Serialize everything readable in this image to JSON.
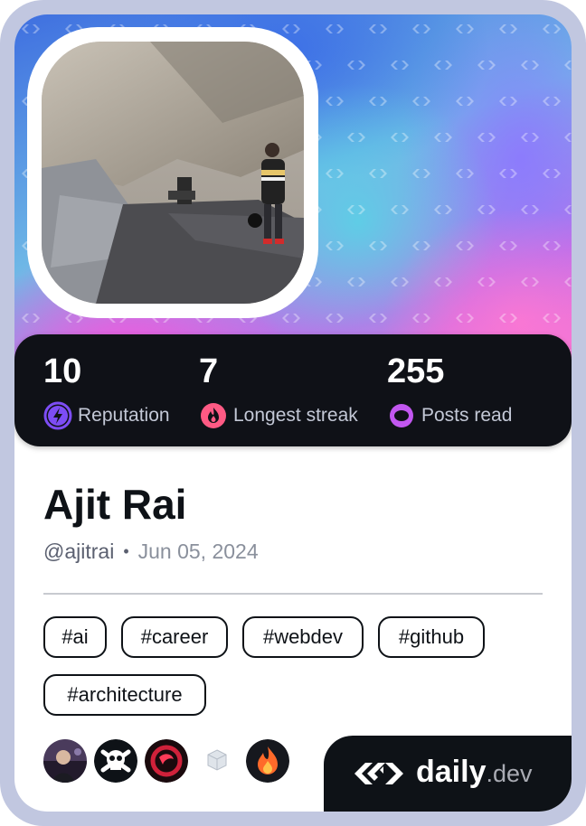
{
  "profile": {
    "name": "Ajit Rai",
    "handle": "@ajitrai",
    "separator": "•",
    "date": "Jun 05, 2024"
  },
  "stats": [
    {
      "value": "10",
      "label": "Reputation",
      "icon": "lightning-icon",
      "color": "#7d4df5"
    },
    {
      "value": "7",
      "label": "Longest streak",
      "icon": "flame-icon",
      "color": "#ff5a84"
    },
    {
      "value": "255",
      "label": "Posts read",
      "icon": "eye-icon",
      "color": "#c257f0"
    }
  ],
  "tags": [
    "#ai",
    "#career",
    "#webdev",
    "#github",
    "#architecture"
  ],
  "badges": [
    "user-avatar-badge",
    "skull-crossbones-badge",
    "red-ring-badge",
    "cube-badge",
    "flame-badge"
  ],
  "brand": {
    "name": "daily",
    "suffix": ".dev"
  },
  "colors": {
    "frame": "#c1c7e0",
    "dark": "#0e1217",
    "stat_label": "#c3c8d6"
  }
}
